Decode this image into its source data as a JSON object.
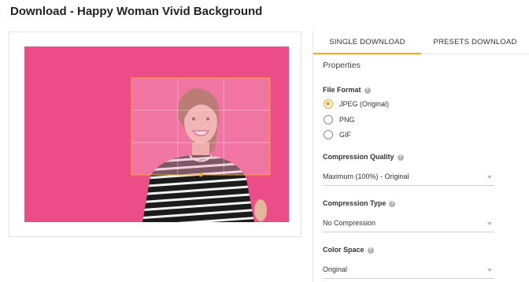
{
  "page": {
    "title": "Download - Happy Woman Vivid Background"
  },
  "tabs": [
    {
      "label": "SINGLE DOWNLOAD",
      "active": true
    },
    {
      "label": "PRESETS DOWNLOAD",
      "active": false
    }
  ],
  "properties": {
    "heading": "Properties",
    "file_format": {
      "label": "File Format",
      "options": [
        "JPEG (Original)",
        "PNG",
        "GIF"
      ],
      "selected": "JPEG (Original)"
    },
    "compression_quality": {
      "label": "Compression Quality",
      "value": "Maximum (100%) - Original"
    },
    "compression_type": {
      "label": "Compression Type",
      "value": "No Compression"
    },
    "color_space": {
      "label": "Color Space",
      "value": "Original"
    }
  },
  "colors": {
    "accent": "#f5a623",
    "photo_background": "#ec4d89",
    "crop_overlay": "#f7a6c4"
  },
  "icons": {
    "help": "help-circle-icon",
    "dropdown": "chevron-down-icon"
  }
}
